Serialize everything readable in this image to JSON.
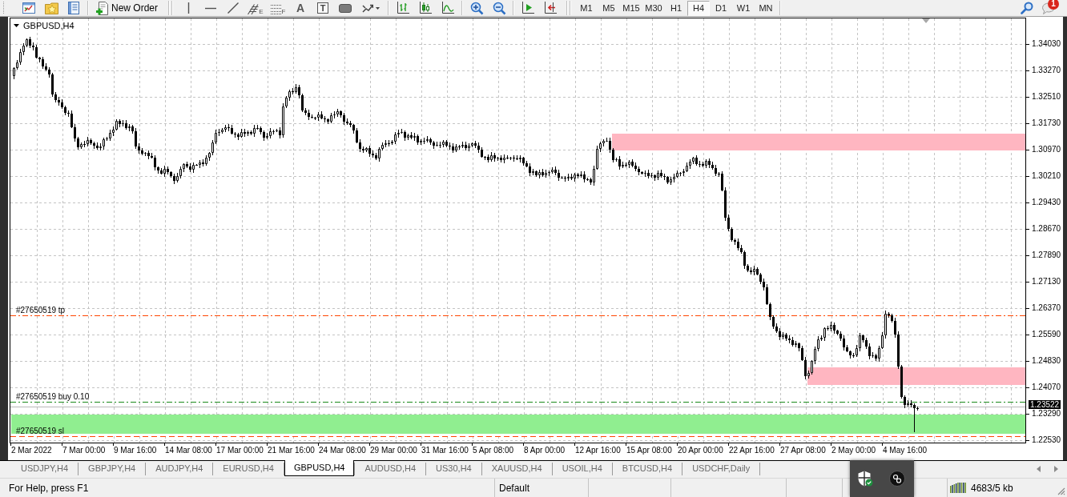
{
  "toolbar": {
    "new_order": "New Order",
    "hatch_tool_letter": "E",
    "dotted_tool_letter": "F",
    "text_tool": "A",
    "text_box_tool": "T"
  },
  "timeframes": [
    {
      "label": "M1",
      "selected": false
    },
    {
      "label": "M5",
      "selected": false
    },
    {
      "label": "M15",
      "selected": false
    },
    {
      "label": "M30",
      "selected": false
    },
    {
      "label": "H1",
      "selected": false
    },
    {
      "label": "H4",
      "selected": true
    },
    {
      "label": "D1",
      "selected": false
    },
    {
      "label": "W1",
      "selected": false
    },
    {
      "label": "MN",
      "selected": false
    }
  ],
  "notifications": {
    "count": "1"
  },
  "chart": {
    "title": "GBPUSD,H4",
    "price_labels": [
      "1.34030",
      "1.33270",
      "1.32510",
      "1.31730",
      "1.30970",
      "1.30210",
      "1.29430",
      "1.28670",
      "1.27890",
      "1.27130",
      "1.26370",
      "1.25590",
      "1.24830",
      "1.24070",
      "1.23290",
      "1.22530"
    ],
    "current_price": "1.23522",
    "time_labels": [
      "2 Mar 2022",
      "7 Mar 00:00",
      "9 Mar 16:00",
      "14 Mar 08:00",
      "17 Mar 00:00",
      "21 Mar 16:00",
      "24 Mar 08:00",
      "29 Mar 00:00",
      "31 Mar 16:00",
      "5 Apr 08:00",
      "8 Apr 00:00",
      "12 Apr 16:00",
      "15 Apr 08:00",
      "20 Apr 00:00",
      "22 Apr 16:00",
      "27 Apr 08:00",
      "2 May 00:00",
      "4 May 16:00"
    ],
    "zones": [
      {
        "color": "#ffb6c1"
      },
      {
        "color": "#ffb6c1"
      },
      {
        "color": "#90ee90"
      }
    ],
    "order_lines": [
      {
        "kind": "take-profit",
        "label": "#27650519 tp"
      },
      {
        "kind": "buy",
        "label": "#27650519 buy 0.10"
      },
      {
        "kind": "stop-loss",
        "label": "#27650519 sl"
      }
    ]
  },
  "tabs": [
    {
      "label": "USDJPY,H4",
      "selected": false
    },
    {
      "label": "GBPJPY,H4",
      "selected": false
    },
    {
      "label": "AUDJPY,H4",
      "selected": false
    },
    {
      "label": "EURUSD,H4",
      "selected": false
    },
    {
      "label": "GBPUSD,H4",
      "selected": true
    },
    {
      "label": "AUDUSD,H4",
      "selected": false
    },
    {
      "label": "US30,H4",
      "selected": false
    },
    {
      "label": "XAUUSD,H4",
      "selected": false
    },
    {
      "label": "USOIL,H4",
      "selected": false
    },
    {
      "label": "BTCUSD,H4",
      "selected": false
    },
    {
      "label": "USDCHF,Daily",
      "selected": false
    }
  ],
  "status_bar": {
    "help": "For Help, press F1",
    "profile": "Default",
    "traffic": "4683/5 kb"
  }
}
